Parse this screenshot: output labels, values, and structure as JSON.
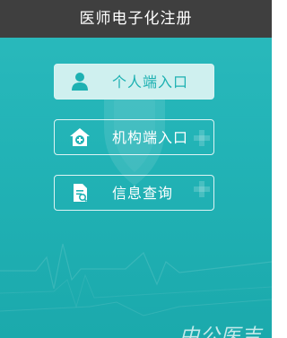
{
  "window": {
    "title": "医师电子化注册"
  },
  "entries": [
    {
      "label": "个人端入口",
      "icon": "person-icon",
      "highlighted": true
    },
    {
      "label": "机构端入口",
      "icon": "hospital-house-icon",
      "highlighted": false
    },
    {
      "label": "信息查询",
      "icon": "document-search-icon",
      "highlighted": false
    }
  ],
  "watermark": {
    "text": "中公医吉"
  },
  "colors": {
    "titlebar": "#3f3f3f",
    "background": "#22b3b6",
    "highlight_button": "#cff0ef",
    "highlight_text": "#1eb1b2"
  }
}
